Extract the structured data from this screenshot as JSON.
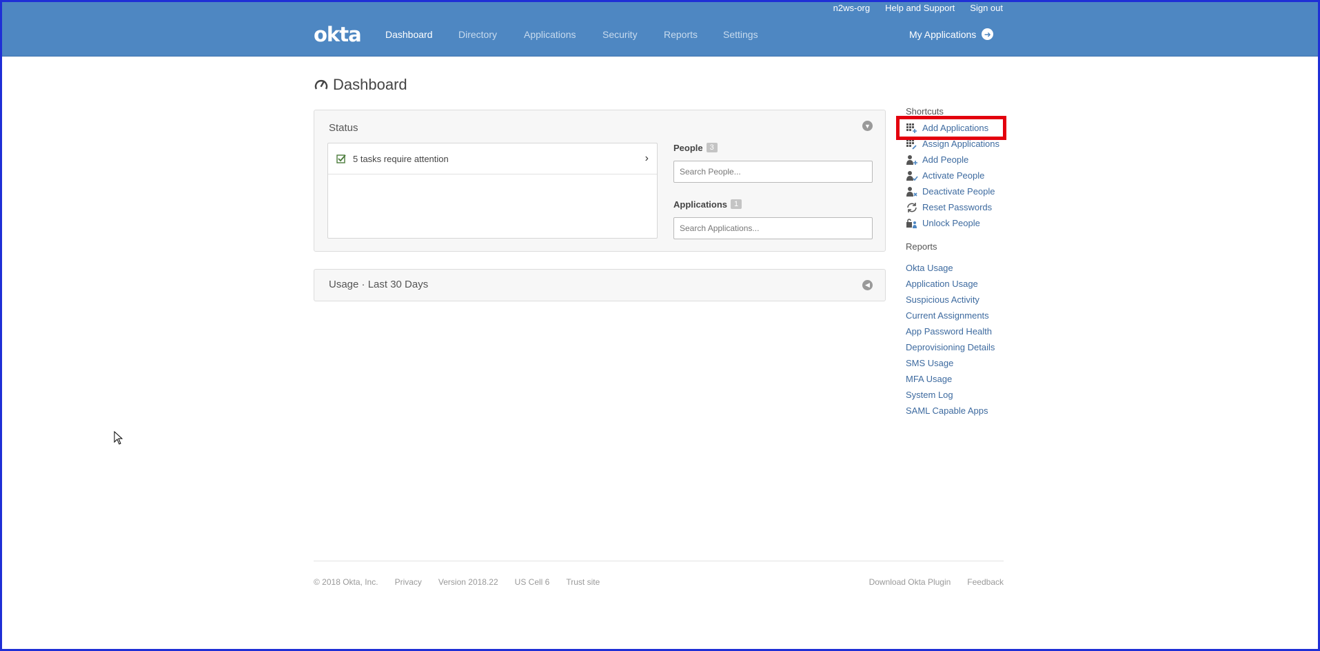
{
  "top_links": {
    "org_name": "n2ws-org",
    "help": "Help and Support",
    "sign_out": "Sign out"
  },
  "header": {
    "logo": "okta",
    "nav": [
      "Dashboard",
      "Directory",
      "Applications",
      "Security",
      "Reports",
      "Settings"
    ],
    "active_nav": "Dashboard",
    "my_applications": "My Applications"
  },
  "page": {
    "title": "Dashboard"
  },
  "status_panel": {
    "title": "Status",
    "task_text": "5 tasks require attention",
    "people_label": "People",
    "people_count": "3",
    "people_placeholder": "Search People...",
    "apps_label": "Applications",
    "apps_count": "1",
    "apps_placeholder": "Search Applications..."
  },
  "usage_panel": {
    "title": "Usage · Last 30 Days"
  },
  "shortcuts": {
    "heading": "Shortcuts",
    "items": [
      {
        "label": "Add Applications",
        "icon": "grid-add-icon"
      },
      {
        "label": "Assign Applications",
        "icon": "grid-assign-icon"
      },
      {
        "label": "Add People",
        "icon": "person-add-icon"
      },
      {
        "label": "Activate People",
        "icon": "person-check-icon"
      },
      {
        "label": "Deactivate People",
        "icon": "person-x-icon"
      },
      {
        "label": "Reset Passwords",
        "icon": "refresh-icon"
      },
      {
        "label": "Unlock People",
        "icon": "lock-person-icon"
      }
    ]
  },
  "reports": {
    "heading": "Reports",
    "items": [
      "Okta Usage",
      "Application Usage",
      "Suspicious Activity",
      "Current Assignments",
      "App Password Health",
      "Deprovisioning Details",
      "SMS Usage",
      "MFA Usage",
      "System Log",
      "SAML Capable Apps"
    ]
  },
  "footer": {
    "copyright": "© 2018 Okta, Inc.",
    "privacy": "Privacy",
    "version": "Version 2018.22",
    "cell": "US Cell 6",
    "trust": "Trust site",
    "download": "Download Okta Plugin",
    "feedback": "Feedback"
  },
  "colors": {
    "header_bg": "#4e87c2",
    "link": "#3d6a9f",
    "highlight_box": "#e3000e",
    "frame": "#1f2fd6"
  }
}
